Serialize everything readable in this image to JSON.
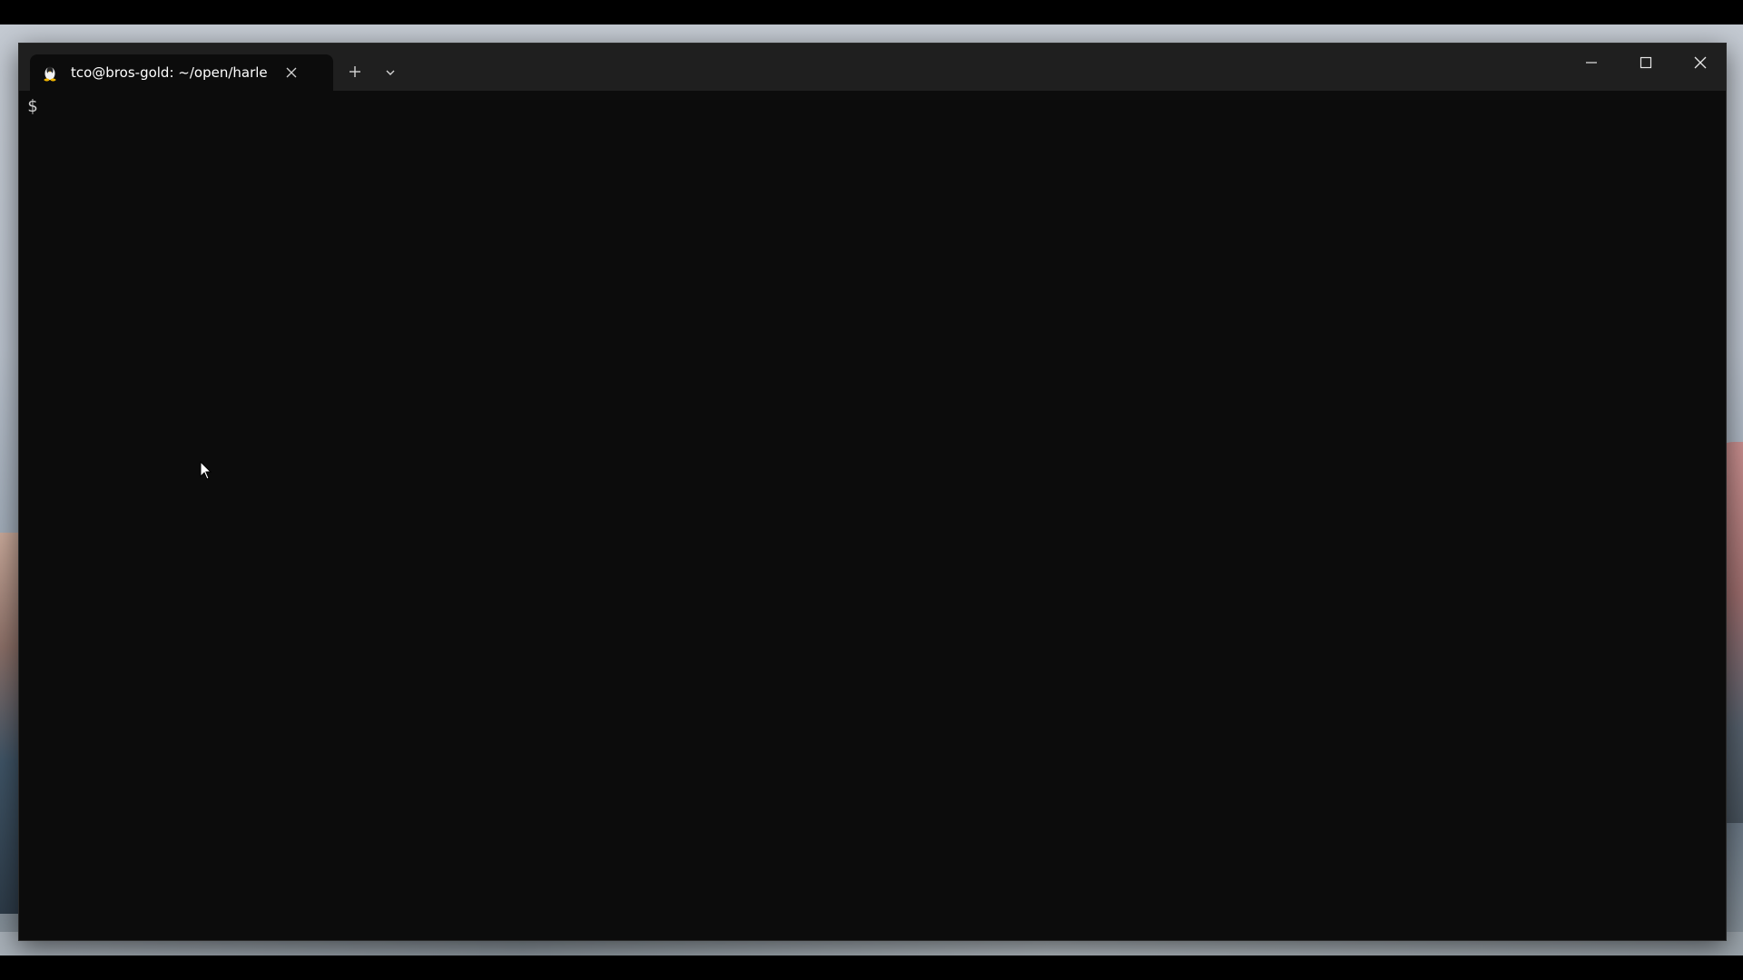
{
  "window": {
    "tab_title": "tco@bros-gold: ~/open/harle",
    "tab_icon": "linux-penguin-icon",
    "new_tab_icon": "plus-icon",
    "dropdown_icon": "chevron-down-icon",
    "controls": {
      "minimize_icon": "minimize-icon",
      "maximize_icon": "maximize-icon",
      "close_icon": "close-icon"
    }
  },
  "terminal": {
    "prompt": "$"
  },
  "colors": {
    "terminal_bg": "#0c0c0c",
    "titlebar_bg": "#1f1f1f",
    "text": "#cccccc",
    "tab_text": "#ffffff"
  }
}
